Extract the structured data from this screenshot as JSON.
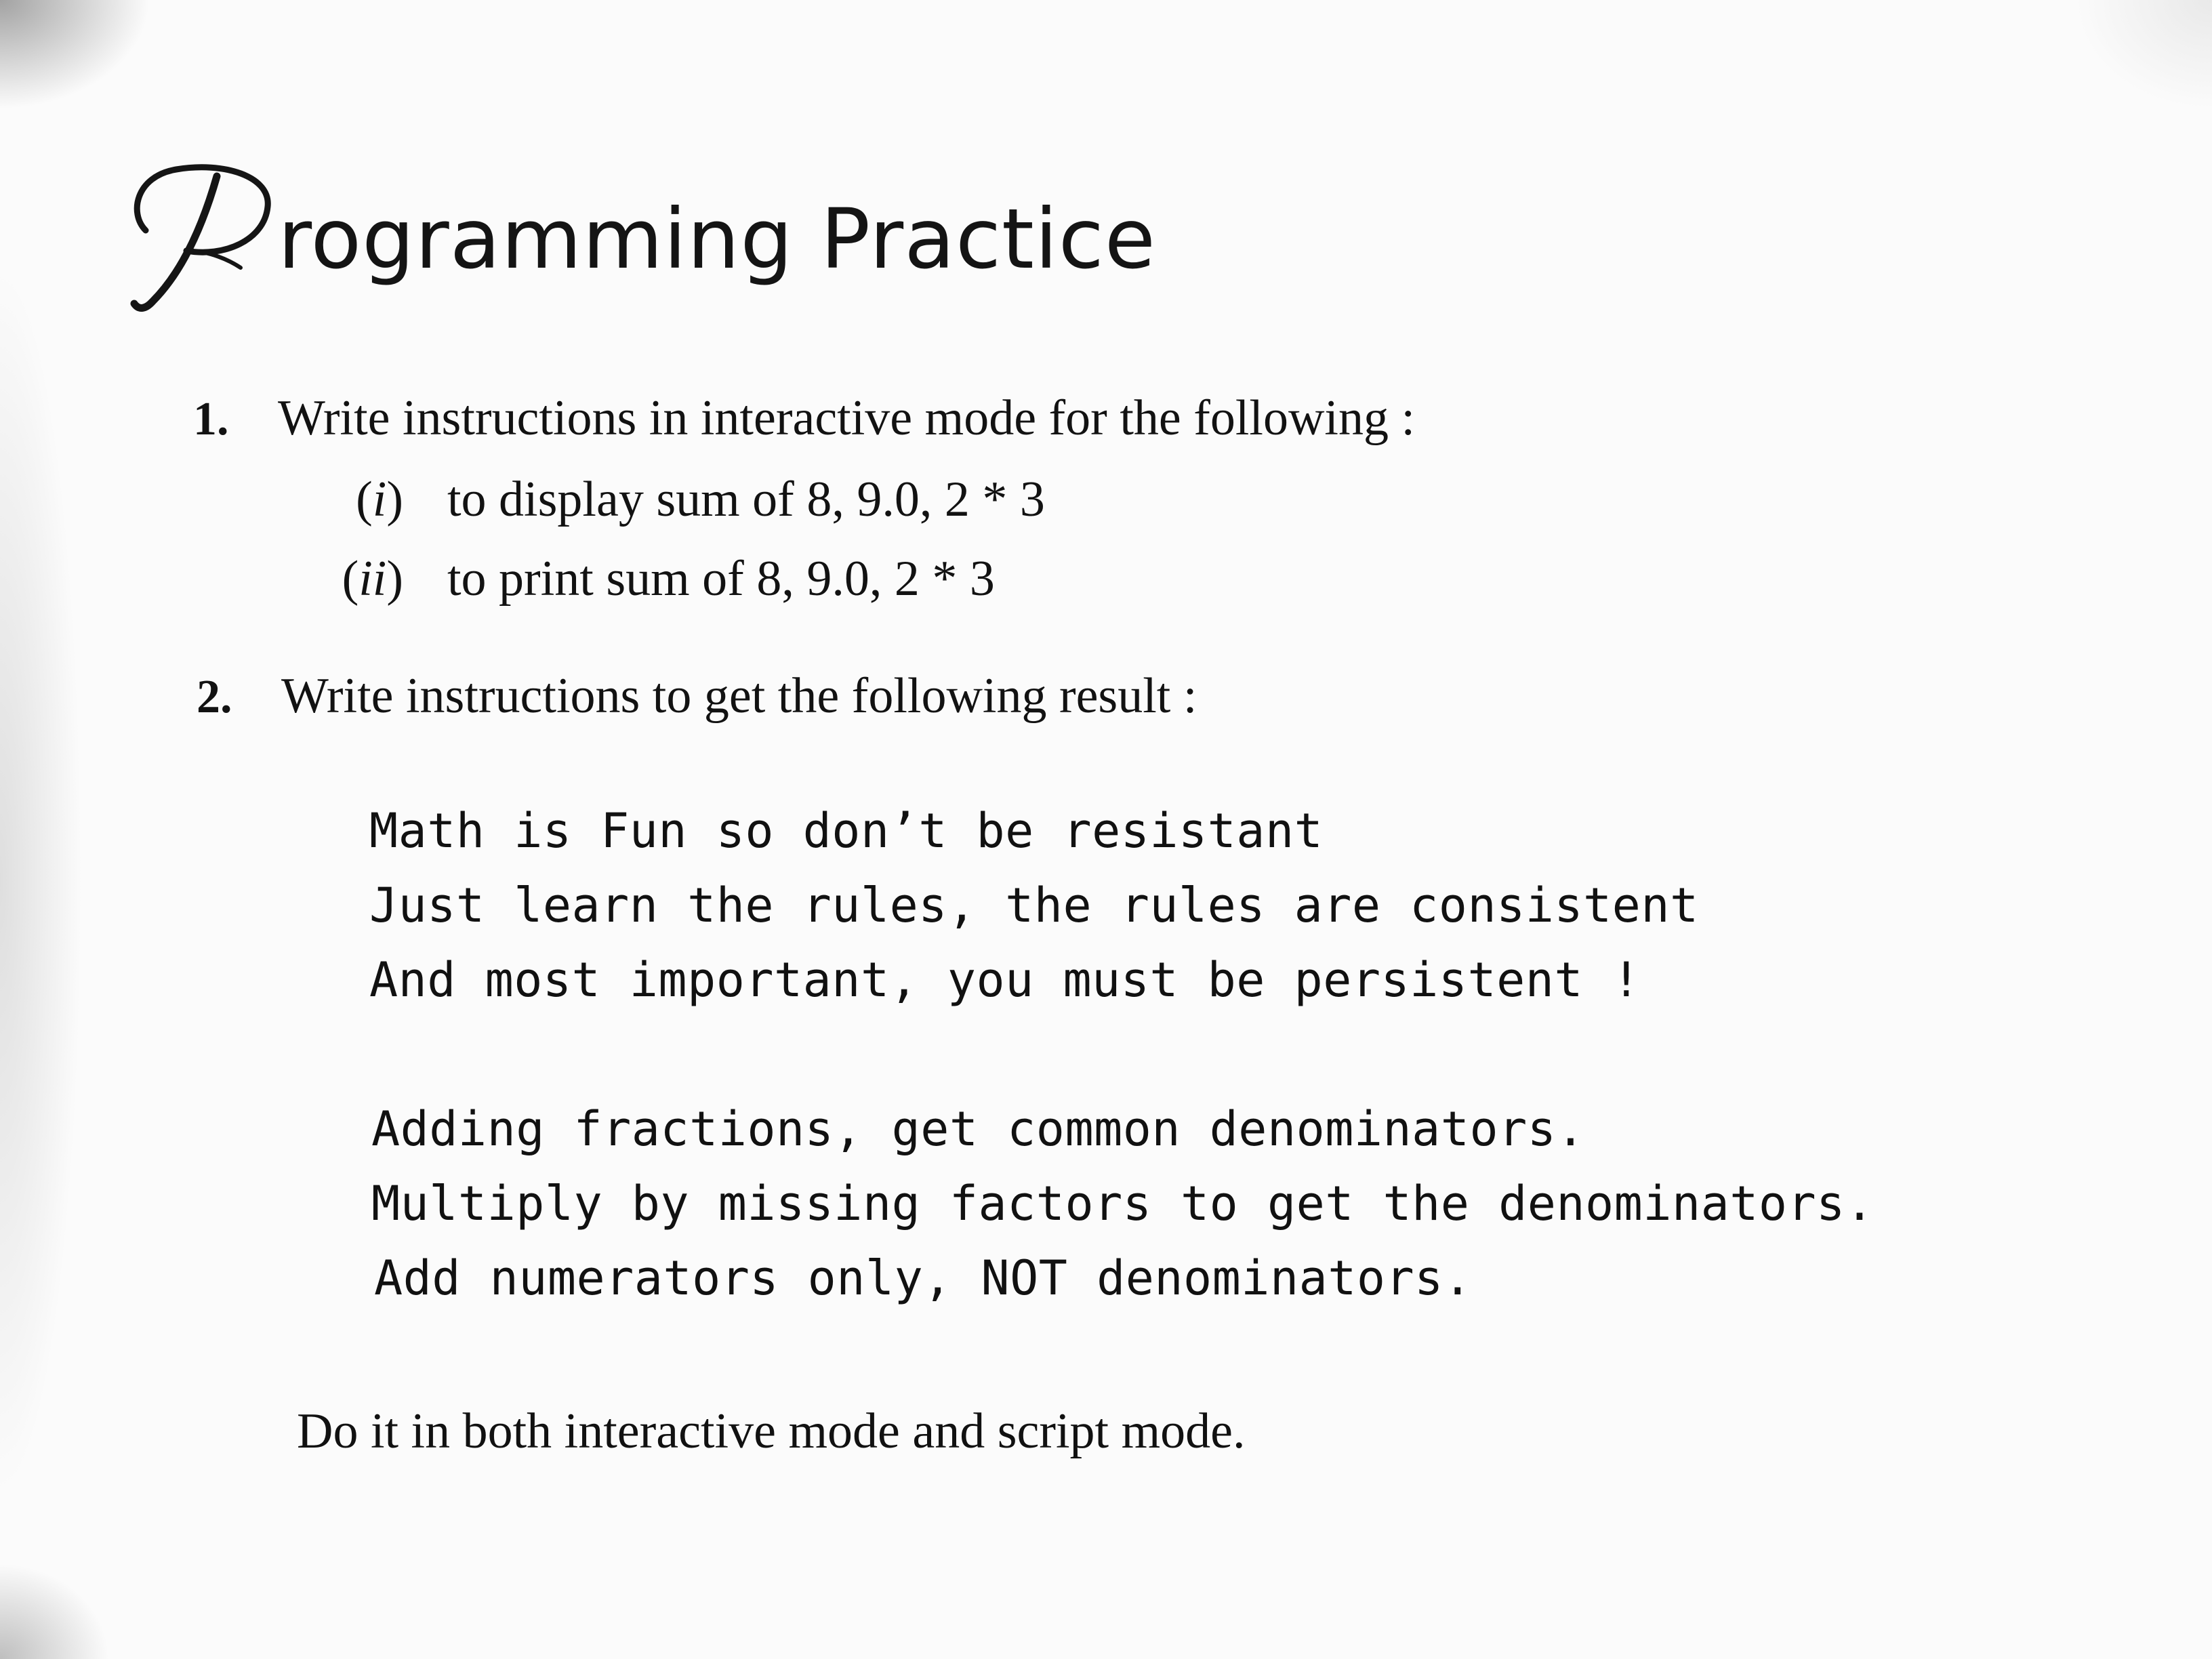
{
  "heading": {
    "initial": "P",
    "rest": "rogramming Practice"
  },
  "questions": [
    {
      "number": "1.",
      "text": "Write instructions in interactive mode for the following :",
      "items": [
        {
          "label_open": "(",
          "label_roman": "i",
          "label_close": ")",
          "text": "to display sum of 8, 9.0, 2 * 3"
        },
        {
          "label_open": "(",
          "label_roman": "ii",
          "label_close": ")",
          "text": "to print sum of 8, 9.0, 2 * 3"
        }
      ]
    },
    {
      "number": "2.",
      "text": "Write instructions to get the following result :",
      "output_lines": [
        "Math is Fun so don’t be resistant",
        "Just learn the rules, the rules are consistent",
        "And most important, you must be persistent !",
        "Adding fractions, get common denominators.",
        "Multiply by missing factors to get the denominators.",
        "Add numerators only, NOT denominators."
      ]
    }
  ],
  "footer": "Do it in both interactive mode and script mode."
}
